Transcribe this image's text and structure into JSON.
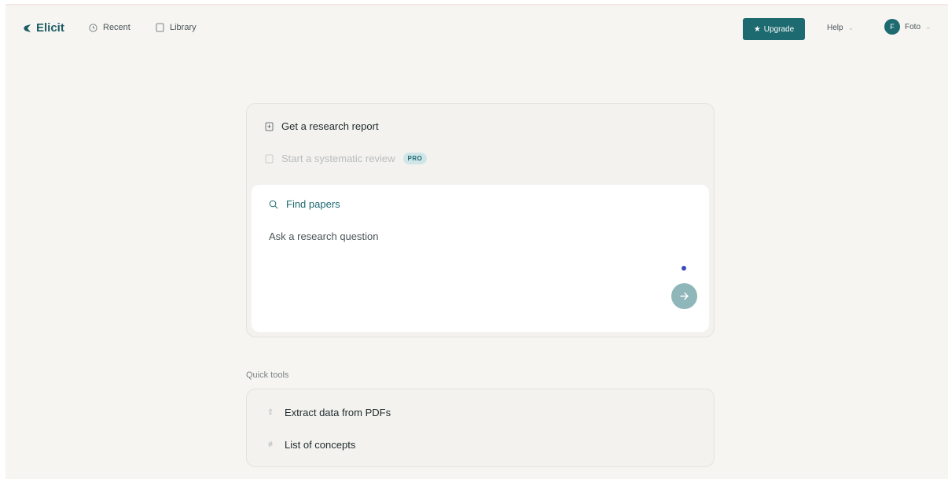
{
  "nav": {
    "brand": "Elicit",
    "recent": "Recent",
    "library": "Library",
    "upgrade": "Upgrade",
    "help": "Help",
    "avatar_initial": "F",
    "user": "Foto"
  },
  "main": {
    "options": [
      {
        "label": "Get a research report",
        "icon": "report-icon"
      },
      {
        "label": "Start a systematic review",
        "icon": "document-icon",
        "badge": "PRO"
      }
    ],
    "find_papers": "Find papers",
    "question_placeholder": "Ask a research question"
  },
  "quick_tools": {
    "title": "Quick tools",
    "items": [
      {
        "label": "Extract data from PDFs",
        "icon": "upload-icon"
      },
      {
        "label": "List of concepts",
        "icon": "hash-icon"
      }
    ]
  },
  "colors": {
    "accent": "#1d6a70",
    "background": "#f6f5f1",
    "submit": "#8fb6b9",
    "dot": "#3b4bbb"
  }
}
